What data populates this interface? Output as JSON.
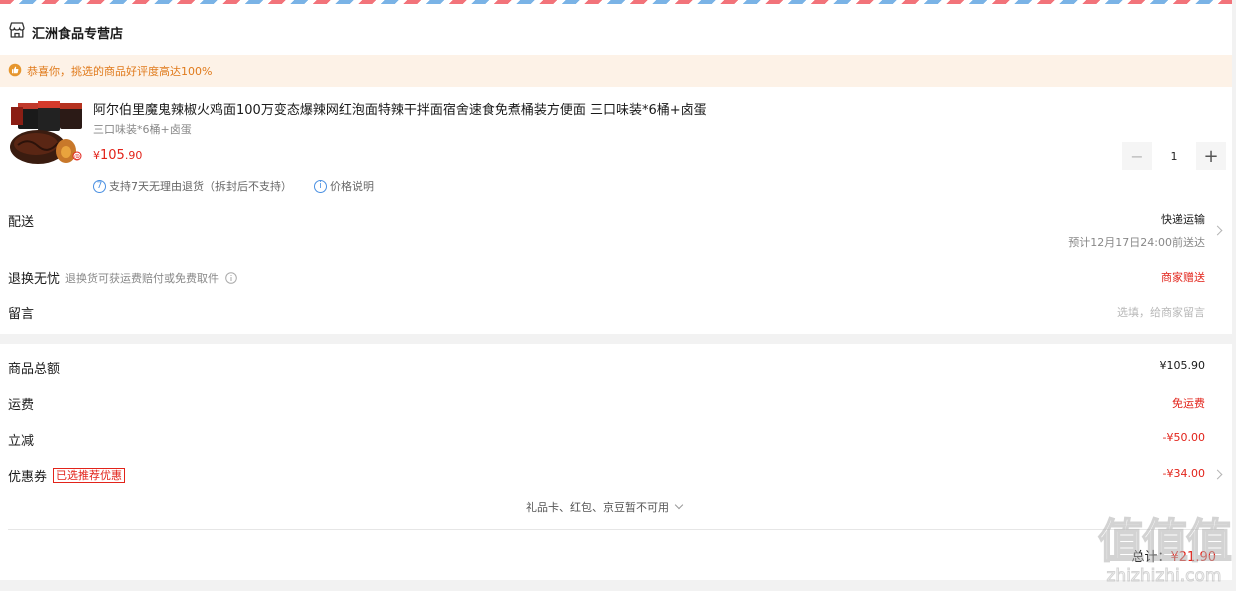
{
  "store": {
    "name": "汇洲食品专营店",
    "icon": "store-icon"
  },
  "banner": {
    "text": "恭喜你，挑选的商品好评度高达100%",
    "icon": "thumb-up-icon"
  },
  "product": {
    "name": "阿尔伯里魔鬼辣椒火鸡面100万变态爆辣网红泡面特辣干拌面宿舍速食免煮桶装方便面 三口味装*6桶+卤蛋",
    "spec": "三口味装*6桶+卤蛋",
    "price_currency": "¥",
    "price_int": "105",
    "price_dec": ".90",
    "quantity": "1",
    "minus": "−",
    "plus": "+",
    "service_badge": "7",
    "service_text": "支持7天无理由退货（拆封后不支持）",
    "price_note_badge": "i",
    "price_note": "价格说明"
  },
  "delivery": {
    "label": "配送",
    "method": "快递运输",
    "eta": "预计12月17日24:00前送达"
  },
  "returns": {
    "label": "退换无忧",
    "desc": "退换货可获运费赔付或免费取件",
    "value": "商家赠送"
  },
  "message": {
    "label": "留言",
    "placeholder": "选填，给商家留言"
  },
  "summary": {
    "goods_label": "商品总额",
    "goods_value": "¥105.90",
    "shipping_label": "运费",
    "shipping_value": "免运费",
    "discount_label": "立减",
    "discount_value": "-¥50.00",
    "coupon_label": "优惠券",
    "coupon_tag": "已选推荐优惠",
    "coupon_value": "-¥34.00",
    "giftcard_text": "礼品卡、红包、京豆暂不可用",
    "total_label": "总计：",
    "total_value": "¥21.90"
  },
  "watermark": {
    "big": "值",
    "small": "zhizhizhi.com"
  },
  "colors": {
    "accent_red": "#e2231a",
    "banner_bg": "#fdf2e7",
    "banner_text": "#e07a1b",
    "info_blue": "#4a90e2"
  }
}
